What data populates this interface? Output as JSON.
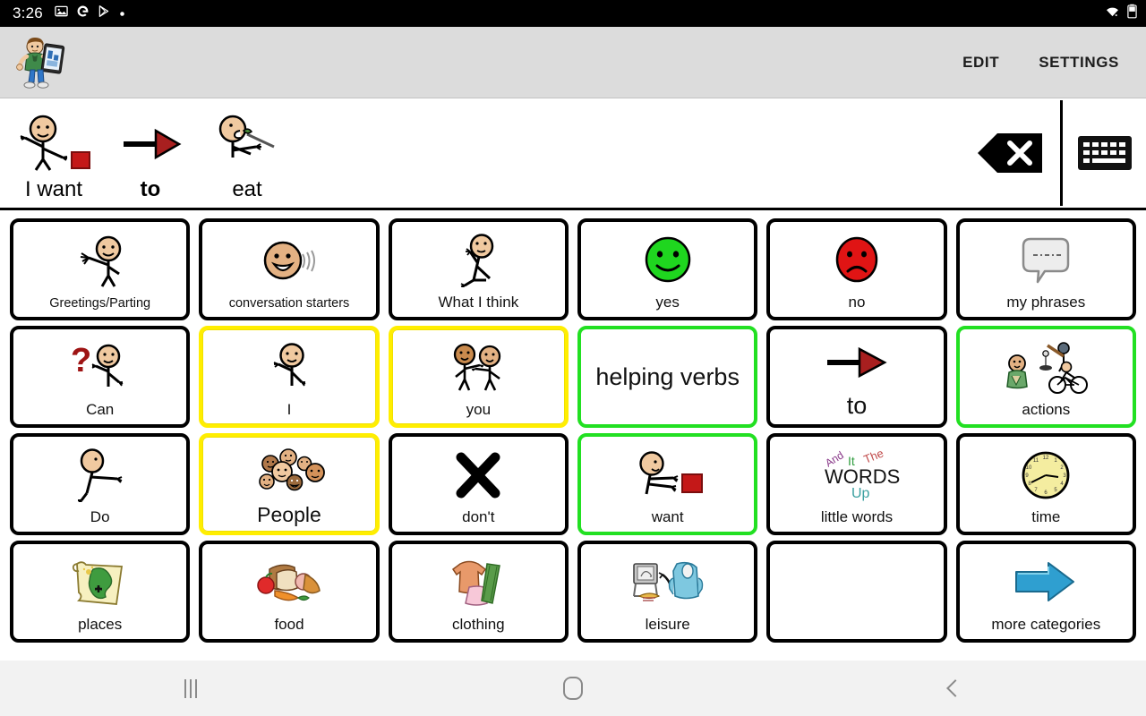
{
  "status_bar": {
    "time": "3:26",
    "left_icons": [
      "image-icon",
      "google-icon",
      "play-store-icon",
      "dot-icon"
    ],
    "right_icons": [
      "wifi-icon",
      "battery-icon"
    ]
  },
  "header": {
    "logo": "boy-with-tablet-logo",
    "edit_label": "EDIT",
    "settings_label": "SETTINGS"
  },
  "sentence_bar": {
    "words": [
      {
        "label": "I want",
        "symbol": "person-wanting-block-icon",
        "bold": false
      },
      {
        "label": "to",
        "symbol": "red-arrow-icon",
        "bold": true
      },
      {
        "label": "eat",
        "symbol": "person-eating-icon",
        "bold": false
      }
    ],
    "clear_button": "backspace-clear-icon",
    "keyboard_button": "keyboard-icon"
  },
  "colors": {
    "border_default": "#000000",
    "border_yellow": "#ffee00",
    "border_green": "#22e022",
    "header_bg": "#dcdcdc",
    "navbar_bg": "#f2f2f2",
    "accent_red": "#cc1111",
    "accent_green": "#22cc22",
    "accent_blue": "#2f9fd0"
  },
  "grid": {
    "columns": 6,
    "rows": 4,
    "buttons": [
      {
        "label": "Greetings/Parting",
        "symbol": "waving-person-icon",
        "border": "black",
        "size": "sm"
      },
      {
        "label": "conversation starters",
        "symbol": "talking-face-icon",
        "border": "black",
        "size": "sm"
      },
      {
        "label": "What I think",
        "symbol": "thinking-person-icon",
        "border": "black",
        "size": "md"
      },
      {
        "label": "yes",
        "symbol": "green-smiley-icon",
        "border": "black",
        "size": "md"
      },
      {
        "label": "no",
        "symbol": "red-frowning-face-icon",
        "border": "black",
        "size": "md"
      },
      {
        "label": "my phrases",
        "symbol": "speech-bubble-icon",
        "border": "black",
        "size": "md"
      },
      {
        "label": "Can",
        "symbol": "question-mark-person-icon",
        "border": "black",
        "size": "md"
      },
      {
        "label": "I",
        "symbol": "person-pointing-self-icon",
        "border": "yellow",
        "size": "md"
      },
      {
        "label": "you",
        "symbol": "two-people-pointing-icon",
        "border": "yellow",
        "size": "md"
      },
      {
        "label": "helping verbs",
        "symbol": "",
        "border": "green",
        "size": "xl",
        "text_only": true
      },
      {
        "label": "to",
        "symbol": "red-arrow-icon",
        "border": "black",
        "size": "xl"
      },
      {
        "label": "actions",
        "symbol": "actions-activities-icon",
        "border": "green",
        "size": "md"
      },
      {
        "label": "Do",
        "symbol": "person-doing-icon",
        "border": "black",
        "size": "md"
      },
      {
        "label": "People",
        "symbol": "group-of-faces-icon",
        "border": "yellow",
        "size": "lg"
      },
      {
        "label": "don't",
        "symbol": "black-x-icon",
        "border": "black",
        "size": "md"
      },
      {
        "label": "want",
        "symbol": "person-wanting-block-icon",
        "border": "green",
        "size": "md"
      },
      {
        "label": "little words",
        "symbol": "word-cloud-icon",
        "border": "black",
        "size": "md"
      },
      {
        "label": "time",
        "symbol": "clock-icon",
        "border": "black",
        "size": "md"
      },
      {
        "label": "places",
        "symbol": "map-scroll-icon",
        "border": "black",
        "size": "md"
      },
      {
        "label": "food",
        "symbol": "food-items-icon",
        "border": "black",
        "size": "md"
      },
      {
        "label": "clothing",
        "symbol": "clothes-icon",
        "border": "black",
        "size": "md"
      },
      {
        "label": "leisure",
        "symbol": "tv-armchair-icon",
        "border": "black",
        "size": "md"
      },
      {
        "label": "",
        "symbol": "",
        "border": "black",
        "size": "md",
        "empty": true
      },
      {
        "label": "more categories",
        "symbol": "blue-arrow-right-icon",
        "border": "black",
        "size": "md"
      }
    ],
    "word_cloud": {
      "and": "And",
      "it": "It",
      "the": "The",
      "words": "WORDS",
      "up": "Up"
    }
  },
  "nav_bar": {
    "recents_label": "recents-button",
    "home_label": "home-button",
    "back_label": "back-button"
  }
}
